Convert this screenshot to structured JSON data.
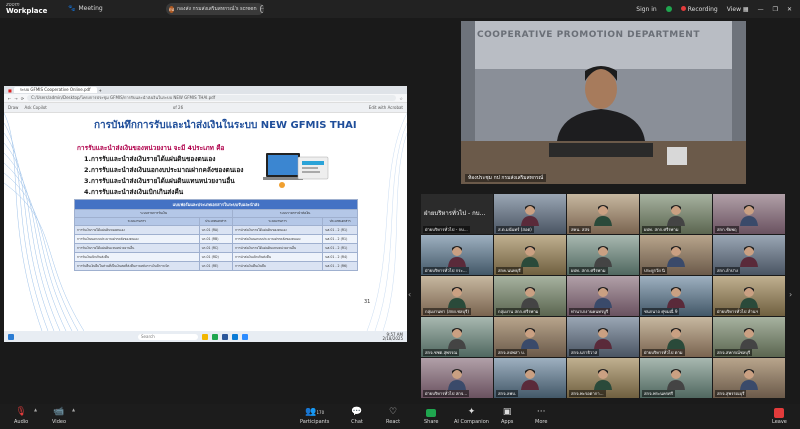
{
  "app": {
    "brand_top": "zoom",
    "brand_bottom": "Workplace",
    "meeting_label": "Meeting",
    "share_indicator": "กองส่ง กรมส่งเสริมสหกรณ์'s screen",
    "share_avatar": "กป"
  },
  "top_right": {
    "signin": "Sign in",
    "recording": "Recording",
    "view": "View"
  },
  "shared_screen": {
    "tab_title": "ระบบ GFMIS Cooperative Online.pdf",
    "address": "C:/Users/admin/Desktop/โครงการประชุม GFMIS/การรับและนำส่งเงินในระบบ NEW GFMIS THAI.pdf",
    "pdf_tools": [
      "Draw",
      "Ask Copilot",
      "of 26",
      "Edit with Acrobat"
    ],
    "slide_title": "การบันทึกการรับและนำส่งเงินในระบบ NEW  GFMIS THAI",
    "slide_subtitle": "การรับและนำส่งเงินของหน่วยงาน จะมี 4ประเภท คือ",
    "slide_items": [
      "1.การรับและนำส่งเงินรายได้แผ่นดินของตนเอง",
      "2.การรับและนำส่งเงินนอกงบประมาณฝากคลังของตนเอง",
      "3.การรับและนำส่งเงินรายได้แผ่นดินแทนหน่วยงานอื่น",
      "4.การรับและนำส่งเงินเบิกเกินส่งคืน"
    ],
    "table": {
      "title": "แบบฟอร์มและประเภทเอกสารในระบบรับและนำส่ง",
      "group_left": "ระบบรายการรับเงิน",
      "group_right": "ระบบรายการนำส่งเงิน",
      "col_headers": [
        "ระบบงานการ",
        "ประเภทเอกสาร",
        "ระบบงานการ",
        "ประเภทเอกสาร"
      ],
      "rows": [
        [
          "การรับเงินรายได้แผ่นดินของตนเอง",
          "นร.01 (RA)",
          "การนำส่งเงินรายได้แผ่นดินของตนเอง",
          "นส.01 - 2 (R1)"
        ],
        [
          "การรับเงินนอกงบประมาณฝากคลังของตนเอง",
          "นร.01 (RB)",
          "การนำส่งเงินนอกงบประมาณฝากคลังของตนเอง",
          "นส.01 - 2 (R1)"
        ],
        [
          "การรับเงินรายได้แผ่นดินแทนหน่วยงานอื่น",
          "นร.01 (RC)",
          "การนำส่งเงินรายได้แผ่นดินแทนหน่วยงานอื่น",
          "นส.01 - 2 (R1)"
        ],
        [
          "การรับเงินเบิกเกินส่งคืน",
          "นร.01 (RD)",
          "การนำส่งเงินเบิกเกินส่งคืน",
          "นส.01 - 2 (R4)"
        ],
        [
          "การรับคืนเงินยืมในส่วนที่เป็นเงินสดที่ส่งคืนภายหลังการเงินมีการเบิก",
          "นร.01 (RE)",
          "การนำส่งเงินคืนเงินยืม",
          "นส.01 - 2 (R6)"
        ]
      ]
    },
    "page_number": "31",
    "taskbar_search": "Search",
    "taskbar_time": "9:57 AM",
    "taskbar_date": "2/18/2025"
  },
  "speaker": {
    "banner_text": "COOPERATIVE PROMOTION DEPARTMENT",
    "name": "ห้องประชุม กป กรมส่งเสริมสหกรณ์"
  },
  "participants": [
    {
      "name": "ฝ่ายบริหารทั่วไป - กบ...",
      "type": "text"
    },
    {
      "name": "ส.ต.มนันทร์ (สอต)",
      "type": "video"
    },
    {
      "name": "สคน. สสจ",
      "type": "video"
    },
    {
      "name": "ผปท. สกก.ศรีรพาม",
      "type": "video"
    },
    {
      "name": "สกก.ชัยพฤ",
      "type": "video"
    },
    {
      "name": "ฝ่ายบริหารทั่วไป กระ...",
      "type": "video"
    },
    {
      "name": "สกค.นนทบุรี",
      "type": "video"
    },
    {
      "name": "ผปท. สกก.ศรีรพาม",
      "type": "video"
    },
    {
      "name": "ประยูรวัย นิ",
      "type": "video"
    },
    {
      "name": "สกก.ลำปาง",
      "type": "video"
    },
    {
      "name": "กลุ่มงานทา (สกย.ชลบุรี)",
      "type": "video"
    },
    {
      "name": "กลุ่มงาน สกก.ศรีรพาม",
      "type": "video"
    },
    {
      "name": "ท่านาเกงานคนทรบูรี",
      "type": "video"
    },
    {
      "name": "ชนกนาถ ศุขมณี่ 9",
      "type": "video"
    },
    {
      "name": "ฝ่ายบริหารทั่วไป ลำนฯ",
      "type": "video"
    },
    {
      "name": "สกจ.ชชต.สุพรรณ",
      "type": "video"
    },
    {
      "name": "สกจ.ลปพสา บ.",
      "type": "video"
    },
    {
      "name": "สกจ.นราธิวาส",
      "type": "video"
    },
    {
      "name": "ฝ่ายบริหารทั่วไป ตาม",
      "type": "video"
    },
    {
      "name": "สกจ.สหกรณ์ชลบุรี",
      "type": "video"
    },
    {
      "name": "ฝ่ายบริหารทั่วไป สกจ...",
      "type": "video"
    },
    {
      "name": "สกจ.ลพบ.",
      "type": "video"
    },
    {
      "name": "สกจ.พะรอตากา...",
      "type": "video"
    },
    {
      "name": "สกจ.พระนครศรี",
      "type": "video"
    },
    {
      "name": "สกจ.สุพรรณบุรี",
      "type": "video"
    },
    {
      "name": "บุคคล หนกรม",
      "type": "video"
    },
    {
      "name": "ฝ่ายบริหารทั่วไป สกจ.ลก...",
      "type": "video"
    },
    {
      "name": "nakhonphanom...",
      "type": "video"
    },
    {
      "name": "นครปฐม",
      "type": "video"
    },
    {
      "name": "สุภาวิยา สกจ.ศรีษกบ",
      "type": "video"
    },
    {
      "name": "สกจ.สิงห์บุรี",
      "type": "video"
    }
  ],
  "bottombar": {
    "audio": "Audio",
    "video": "Video",
    "participants": "Participants",
    "participants_count": "170",
    "chat": "Chat",
    "react": "React",
    "share": "Share",
    "ai_companion": "AI Companion",
    "apps": "Apps",
    "more": "More",
    "leave": "Leave"
  },
  "colors": {
    "zoom_bg": "#1a1a1a",
    "share_green": "#1fa64f",
    "leave_red": "#e23b3b",
    "slide_title_blue": "#1f4e9a",
    "slide_sub_magenta": "#b0004b"
  }
}
